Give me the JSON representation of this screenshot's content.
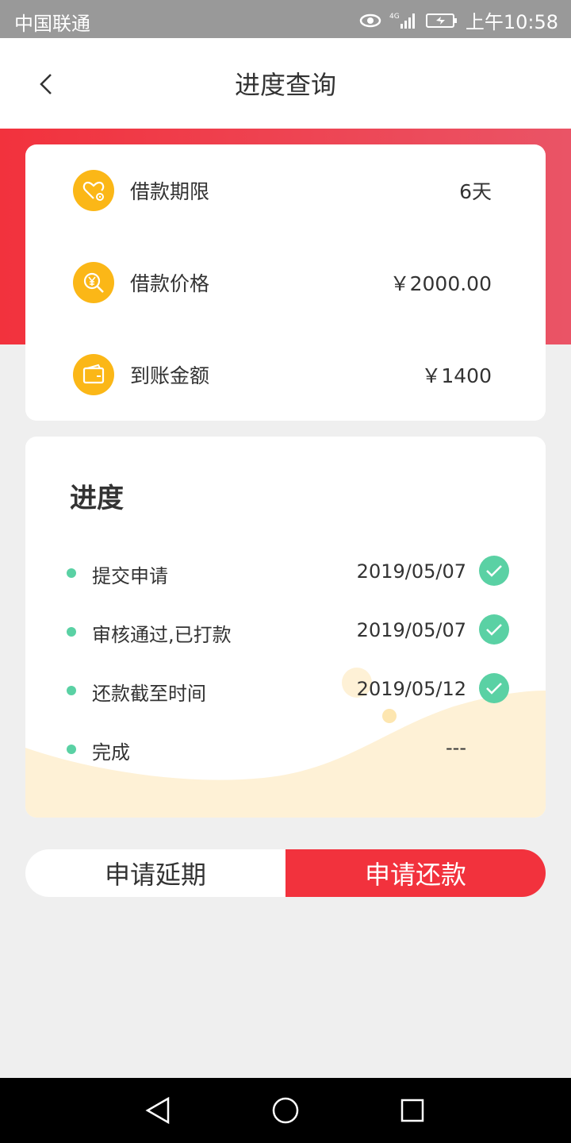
{
  "status_bar": {
    "carrier": "中国联通",
    "network": "4G",
    "time": "上午10:58"
  },
  "header": {
    "title": "进度查询"
  },
  "loan_info": [
    {
      "icon": "heart-gear-icon",
      "label": "借款期限",
      "value": "6天"
    },
    {
      "icon": "yen-search-icon",
      "label": "借款价格",
      "value": "￥2000.00"
    },
    {
      "icon": "wallet-icon",
      "label": "到账金额",
      "value": "￥1400"
    }
  ],
  "progress": {
    "title": "进度",
    "steps": [
      {
        "label": "提交申请",
        "date": "2019/05/07",
        "done": true
      },
      {
        "label": "审核通过,已打款",
        "date": "2019/05/07",
        "done": true
      },
      {
        "label": "还款截至时间",
        "date": "2019/05/12",
        "done": true
      },
      {
        "label": "完成",
        "date": "---",
        "done": false
      }
    ]
  },
  "actions": {
    "extend_label": "申请延期",
    "repay_label": "申请还款"
  },
  "colors": {
    "accent_red": "#f2323d",
    "icon_yellow": "#fbb717",
    "success_green": "#5ad1a4",
    "wave_cream": "#fef1d6"
  }
}
